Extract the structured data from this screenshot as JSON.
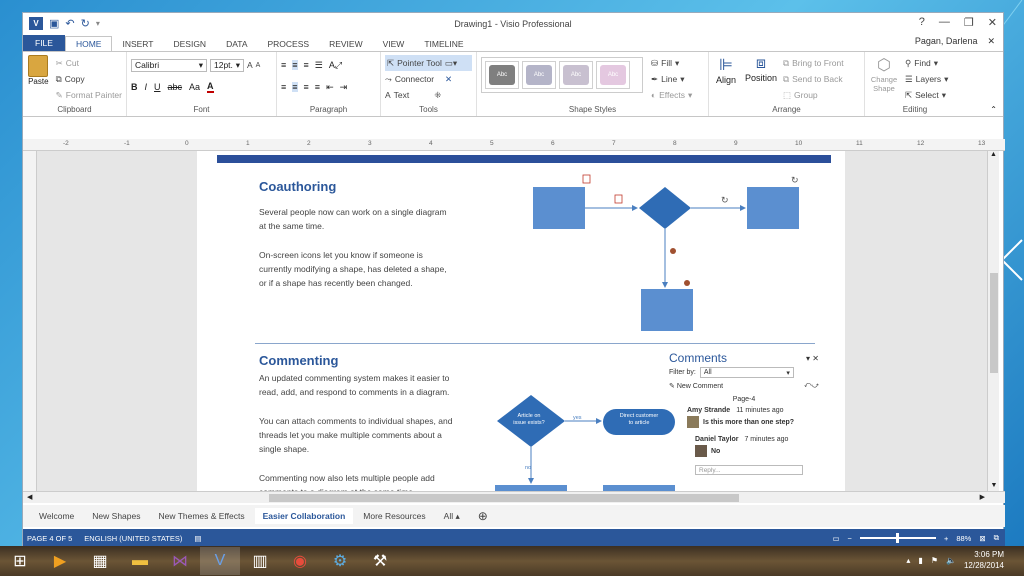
{
  "window": {
    "title": "Drawing1 - Visio Professional",
    "user": "Pagan, Darlena",
    "controls": [
      "?",
      "—",
      "❐",
      "✕"
    ]
  },
  "tabs": [
    "FILE",
    "HOME",
    "INSERT",
    "DESIGN",
    "DATA",
    "PROCESS",
    "REVIEW",
    "VIEW",
    "TIMELINE"
  ],
  "active_tab": "HOME",
  "ribbon": {
    "clipboard": {
      "label": "Clipboard",
      "paste": "Paste",
      "cut": "Cut",
      "copy": "Copy",
      "format_painter": "Format Painter"
    },
    "font": {
      "label": "Font",
      "family": "Calibri",
      "size": "12pt.",
      "grow": "A",
      "shrink": "A",
      "bold": "B",
      "italic": "I",
      "underline": "U",
      "strike": "abc",
      "case": "Aa",
      "color": "A"
    },
    "paragraph": {
      "label": "Paragraph"
    },
    "tools": {
      "label": "Tools",
      "pointer": "Pointer Tool",
      "connector": "Connector",
      "text": "Text"
    },
    "shape_styles": {
      "label": "Shape Styles",
      "swatch": "Abc",
      "fill": "Fill",
      "line": "Line",
      "effects": "Effects"
    },
    "arrange": {
      "label": "Arrange",
      "align": "Align",
      "position": "Position",
      "bring_front": "Bring to Front",
      "send_back": "Send to Back",
      "group": "Group"
    },
    "editing": {
      "label": "Editing",
      "change_shape": "Change Shape",
      "find": "Find",
      "layers": "Layers",
      "select": "Select"
    }
  },
  "ruler_marks": [
    "-2",
    "-1",
    "0",
    "1",
    "2",
    "3",
    "4",
    "5",
    "6",
    "7",
    "8",
    "9",
    "10",
    "11",
    "12",
    "13"
  ],
  "page": {
    "coauthoring": {
      "heading": "Coauthoring",
      "p1": "Several people now can work on a single diagram\nat the same time.",
      "p2": "On-screen icons let you know if someone is\ncurrently modifying a shape, has deleted a shape,\nor if a shape has recently been changed."
    },
    "commenting": {
      "heading": "Commenting",
      "p1": "An updated commenting system makes it easier to\nread, add, and respond to comments in a diagram.",
      "p2": "You can attach comments to individual shapes, and\nthreads let you make multiple comments about a\nsingle shape.",
      "p3": "Commenting now also lets multiple people add\ncomments to a diagram at the same time."
    },
    "flow": {
      "decision": "Article on\nissue exists?",
      "yes": "yes",
      "no": "no",
      "action": "Direct customer\nto article"
    },
    "comments_pane": {
      "title": "Comments",
      "filter_label": "Filter by:",
      "filter_value": "All",
      "new_comment": "New Comment",
      "page": "Page-4",
      "c1_author": "Amy Strande",
      "c1_time": "11 minutes ago",
      "c1_text": "Is this more than one step?",
      "c2_author": "Daniel Taylor",
      "c2_time": "7 minutes ago",
      "c2_text": "No",
      "reply": "Reply..."
    }
  },
  "sheets": [
    "Welcome",
    "New Shapes",
    "New Themes & Effects",
    "Easier Collaboration",
    "More Resources",
    "All ▴"
  ],
  "active_sheet": "Easier Collaboration",
  "status": {
    "page": "PAGE 4 OF 5",
    "language": "ENGLISH (UNITED STATES)",
    "zoom": "88%"
  },
  "taskbar": {
    "time": "3:06 PM",
    "date": "12/28/2014"
  }
}
